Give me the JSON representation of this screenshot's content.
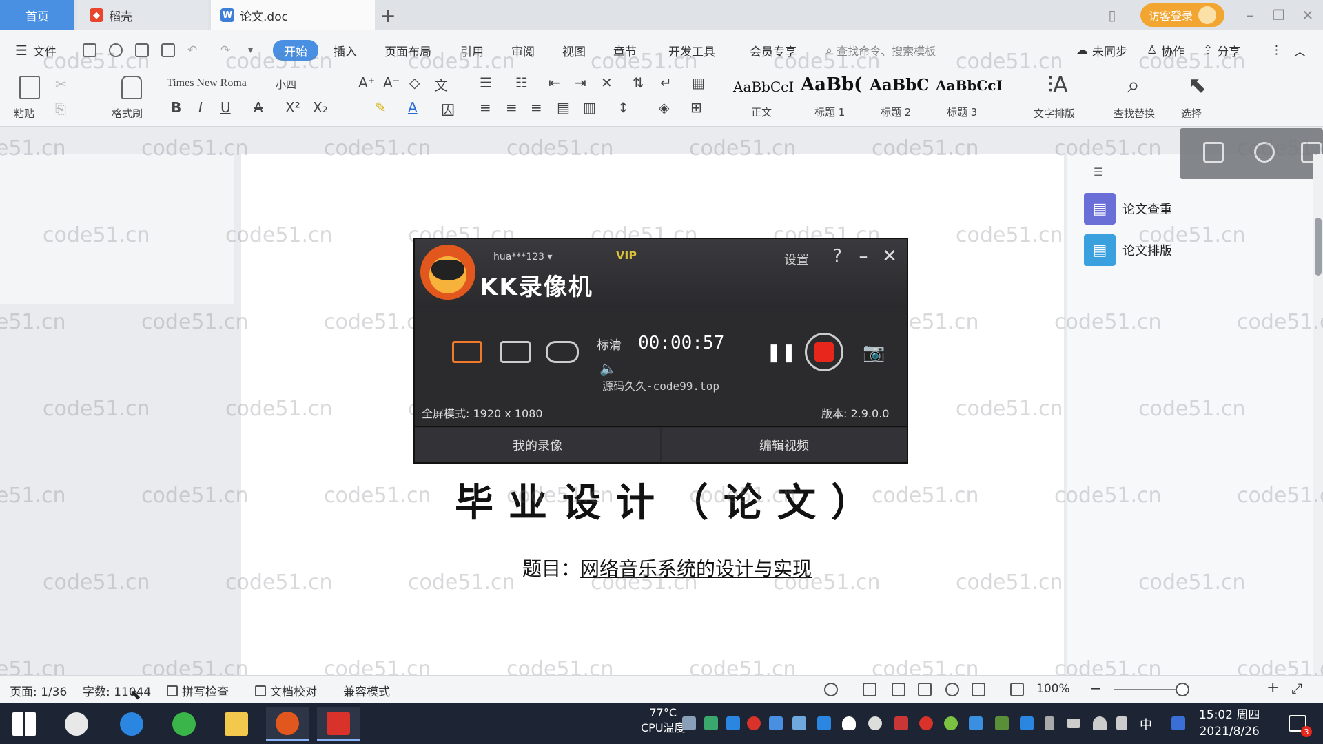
{
  "tabs": {
    "home": "首页",
    "docer": "稻壳",
    "document": "论文.doc",
    "add": "+",
    "login": "访客登录"
  },
  "menu": {
    "file": "文件",
    "items": [
      "开始",
      "插入",
      "页面布局",
      "引用",
      "审阅",
      "视图",
      "章节",
      "开发工具",
      "会员专享"
    ],
    "search": "查找命令、搜索模板",
    "sync": "未同步",
    "collab": "协作",
    "share": "分享"
  },
  "ribbon": {
    "paste": "粘贴",
    "format_painter": "格式刷",
    "font_name": "Times New Roma",
    "font_size": "小四",
    "bold": "B",
    "italic": "I",
    "underline": "U",
    "styles": [
      {
        "preview": "AaBbCcI",
        "label": "正文"
      },
      {
        "preview": "AaBb(",
        "label": "标题 1"
      },
      {
        "preview": "AaBbC",
        "label": "标题 2"
      },
      {
        "preview": "AaBbCcI",
        "label": "标题 3"
      }
    ],
    "text_layout": "文字排版",
    "find_replace": "查找替换",
    "select": "选择"
  },
  "watermark": "code51.cn",
  "document": {
    "title": "毕业设计（论文）",
    "subtitle_label": "题目：",
    "subtitle_value": "网络音乐系统的设计与实现"
  },
  "right_pane": {
    "items": [
      "论文查重",
      "论文排版"
    ]
  },
  "recorder": {
    "title": "KK录像机",
    "user": "hua***123",
    "vip": "VIP",
    "settings": "设置",
    "help": "?",
    "minimize": "–",
    "close": "✕",
    "quality": "标清",
    "timer": "00:00:57",
    "source_watermark": "源码久久-code99.top",
    "mode_text": "全屏模式: 1920 x 1080",
    "version": "版本: 2.9.0.0",
    "my_recordings": "我的录像",
    "edit_video": "编辑视频"
  },
  "statusbar": {
    "page": "页面: 1/36",
    "word_count": "字数: 11044",
    "spell_check": "拼写检查",
    "doc_proof": "文档校对",
    "compat_mode": "兼容模式",
    "zoom": "100%"
  },
  "taskbar": {
    "temp": "77°C",
    "temp_label": "CPU温度",
    "ime": "中",
    "time": "15:02 周四",
    "date": "2021/8/26",
    "notify_count": "3"
  },
  "colors": {
    "accent": "#4a90e2",
    "login": "#f2a531",
    "record": "#e8261c",
    "taskbar": "#1d2433"
  }
}
